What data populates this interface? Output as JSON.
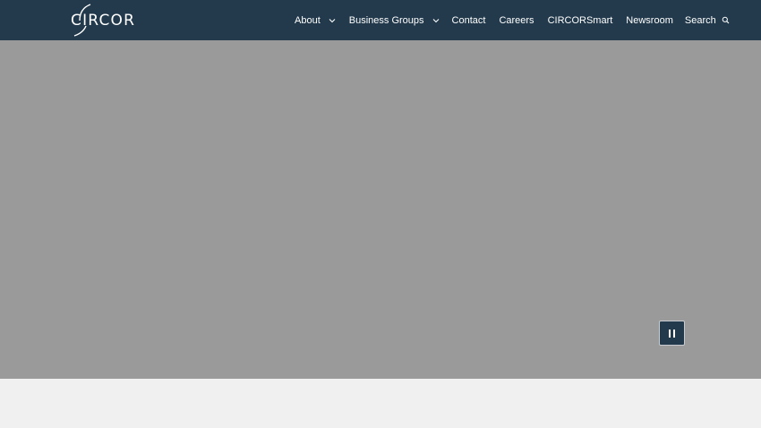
{
  "brand": {
    "name": "CIRCOR"
  },
  "nav": {
    "about": "About",
    "business_groups": "Business Groups",
    "contact": "Contact",
    "careers": "Careers",
    "circorsmart": "CIRCORSmart",
    "newsroom": "Newsroom",
    "search": "Search"
  },
  "icons": {
    "about_dropdown": "chevron-down-icon",
    "business_groups_dropdown": "chevron-down-icon",
    "search": "search-icon",
    "hero_control": "pause-icon"
  },
  "colors": {
    "header_bg": "#223a4c",
    "hero_bg": "#9a9a9a",
    "page_bg": "#f0f0f1",
    "text_light": "#ffffff"
  }
}
